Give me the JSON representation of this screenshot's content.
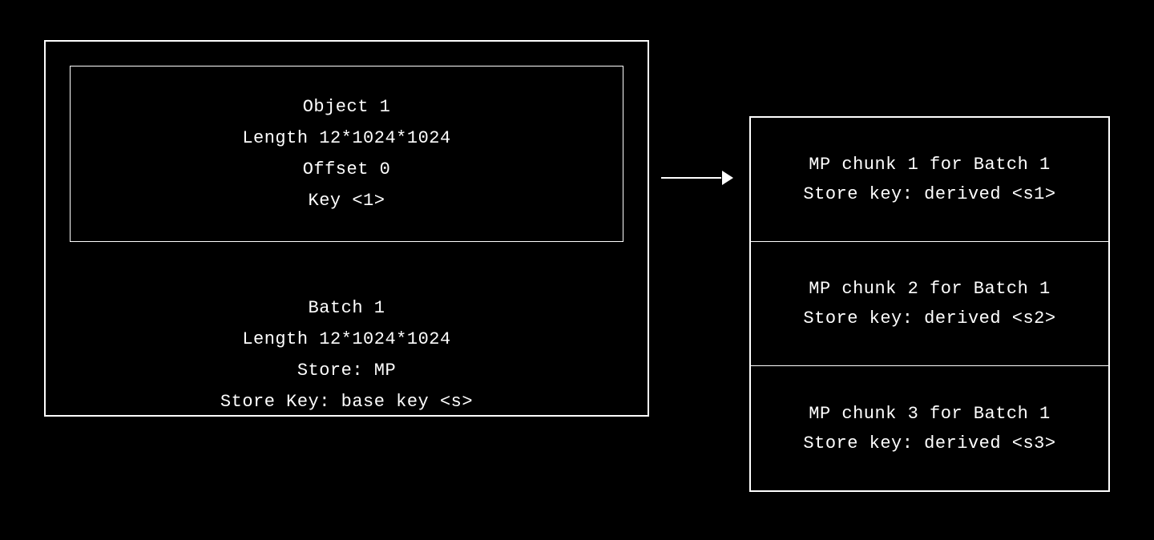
{
  "batch": {
    "object": {
      "title": "Object 1",
      "length": "Length 12*1024*1024",
      "offset": "Offset 0",
      "key": "Key <1>"
    },
    "info": {
      "title": "Batch 1",
      "length": "Length 12*1024*1024",
      "store": "Store: MP",
      "storeKey": "Store Key: base key <s>"
    }
  },
  "chunks": [
    {
      "title": "MP chunk 1 for Batch 1",
      "storeKey": "Store key: derived <s1>"
    },
    {
      "title": "MP chunk 2 for Batch 1",
      "storeKey": "Store key: derived <s2>"
    },
    {
      "title": "MP chunk 3 for Batch 1",
      "storeKey": "Store key: derived <s3>"
    }
  ]
}
